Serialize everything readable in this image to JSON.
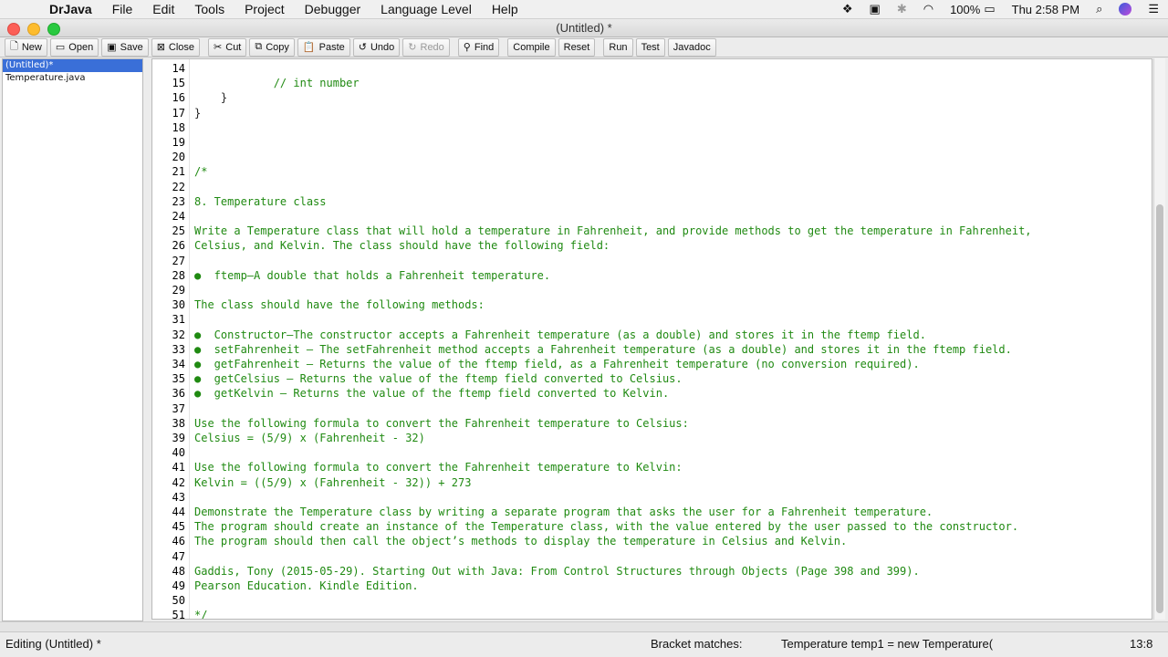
{
  "menubar": {
    "app_name": "DrJava",
    "menus": [
      "File",
      "Edit",
      "Tools",
      "Project",
      "Debugger",
      "Language Level",
      "Help"
    ],
    "battery": "100%",
    "clock": "Thu 2:58 PM"
  },
  "window": {
    "title": "(Untitled) *"
  },
  "toolbar": {
    "buttons": [
      {
        "label": "New",
        "icon": "new-file-icon"
      },
      {
        "label": "Open",
        "icon": "open-folder-icon"
      },
      {
        "label": "Save",
        "icon": "save-icon"
      },
      {
        "label": "Close",
        "icon": "close-icon"
      },
      {
        "label": "Cut",
        "icon": "scissors-icon"
      },
      {
        "label": "Copy",
        "icon": "copy-icon"
      },
      {
        "label": "Paste",
        "icon": "clipboard-icon"
      },
      {
        "label": "Undo",
        "icon": "undo-icon"
      },
      {
        "label": "Redo",
        "icon": "redo-icon"
      },
      {
        "label": "Find",
        "icon": "binoculars-icon"
      },
      {
        "label": "Compile"
      },
      {
        "label": "Reset"
      },
      {
        "label": "Run"
      },
      {
        "label": "Test"
      },
      {
        "label": "Javadoc"
      }
    ]
  },
  "sidebar": {
    "files": [
      {
        "name": "(Untitled)*",
        "selected": true
      },
      {
        "name": "Temperature.java",
        "selected": false
      }
    ]
  },
  "editor": {
    "lines": [
      {
        "n": "14",
        "text": ""
      },
      {
        "n": "15",
        "text": "            // int number"
      },
      {
        "n": "16",
        "text": "    }"
      },
      {
        "n": "17",
        "text": "}"
      },
      {
        "n": "18",
        "text": ""
      },
      {
        "n": "19",
        "text": ""
      },
      {
        "n": "20",
        "text": ""
      },
      {
        "n": "21",
        "text": "/*"
      },
      {
        "n": "22",
        "text": ""
      },
      {
        "n": "23",
        "text": "8. Temperature class"
      },
      {
        "n": "24",
        "text": ""
      },
      {
        "n": "25",
        "text": "Write a Temperature class that will hold a temperature in Fahrenheit, and provide methods to get the temperature in Fahrenheit,"
      },
      {
        "n": "26",
        "text": "Celsius, and Kelvin. The class should have the following field:"
      },
      {
        "n": "27",
        "text": ""
      },
      {
        "n": "28",
        "text": "●  ftemp–A double that holds a Fahrenheit temperature."
      },
      {
        "n": "29",
        "text": ""
      },
      {
        "n": "30",
        "text": "The class should have the following methods:"
      },
      {
        "n": "31",
        "text": ""
      },
      {
        "n": "32",
        "text": "●  Constructor–The constructor accepts a Fahrenheit temperature (as a double) and stores it in the ftemp field."
      },
      {
        "n": "33",
        "text": "●  setFahrenheit – The setFahrenheit method accepts a Fahrenheit temperature (as a double) and stores it in the ftemp field."
      },
      {
        "n": "34",
        "text": "●  getFahrenheit – Returns the value of the ftemp field, as a Fahrenheit temperature (no conversion required)."
      },
      {
        "n": "35",
        "text": "●  getCelsius – Returns the value of the ftemp field converted to Celsius."
      },
      {
        "n": "36",
        "text": "●  getKelvin – Returns the value of the ftemp field converted to Kelvin."
      },
      {
        "n": "37",
        "text": ""
      },
      {
        "n": "38",
        "text": "Use the following formula to convert the Fahrenheit temperature to Celsius:"
      },
      {
        "n": "39",
        "text": "Celsius = (5/9) x (Fahrenheit - 32)"
      },
      {
        "n": "40",
        "text": ""
      },
      {
        "n": "41",
        "text": "Use the following formula to convert the Fahrenheit temperature to Kelvin:"
      },
      {
        "n": "42",
        "text": "Kelvin = ((5/9) x (Fahrenheit - 32)) + 273"
      },
      {
        "n": "43",
        "text": ""
      },
      {
        "n": "44",
        "text": "Demonstrate the Temperature class by writing a separate program that asks the user for a Fahrenheit temperature."
      },
      {
        "n": "45",
        "text": "The program should create an instance of the Temperature class, with the value entered by the user passed to the constructor."
      },
      {
        "n": "46",
        "text": "The program should then call the object’s methods to display the temperature in Celsius and Kelvin."
      },
      {
        "n": "47",
        "text": ""
      },
      {
        "n": "48",
        "text": "Gaddis, Tony (2015-05-29). Starting Out with Java: From Control Structures through Objects (Page 398 and 399)."
      },
      {
        "n": "49",
        "text": "Pearson Education. Kindle Edition."
      },
      {
        "n": "50",
        "text": ""
      },
      {
        "n": "51",
        "text": "*/"
      }
    ]
  },
  "statusbar": {
    "left": "Editing (Untitled) *",
    "bracket_label": "Bracket matches:",
    "bracket_value": "Temperature temp1 = new Temperature(",
    "position": "13:8"
  }
}
